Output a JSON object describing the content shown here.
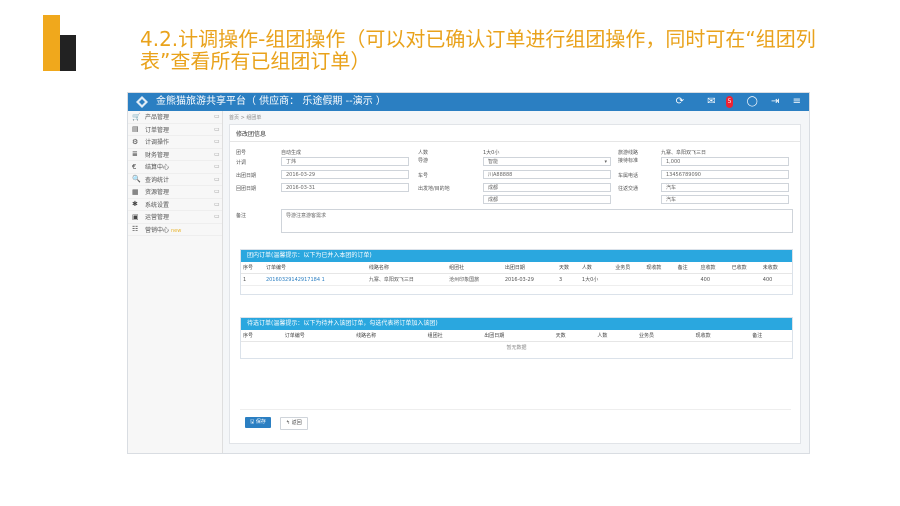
{
  "slide": {
    "title": "4.2.计调操作-组团操作（可以对已确认订单进行组团操作，同时可在“组团列表”查看所有已组团订单）"
  },
  "app": {
    "brand": "金熊猫旅游共享平台（ 供应商： 乐途假期 --演示 ）",
    "toolbar": [
      "⟳",
      "✉",
      "◯",
      "⇥",
      "≡"
    ],
    "mail_badge": "5"
  },
  "sidebar": {
    "items": [
      {
        "icon": "🛒",
        "icon_name": "cart-icon",
        "label": "产品管理"
      },
      {
        "icon": "▤",
        "icon_name": "list-icon",
        "label": "订单管理"
      },
      {
        "icon": "⚙",
        "icon_name": "gear-icon",
        "label": "计调操作"
      },
      {
        "icon": "≣",
        "icon_name": "bars-icon",
        "label": "财务管理"
      },
      {
        "icon": "€",
        "icon_name": "currency-icon",
        "label": "结算中心"
      },
      {
        "icon": "🔍",
        "icon_name": "search-icon",
        "label": "查询统计"
      },
      {
        "icon": "▦",
        "icon_name": "database-icon",
        "label": "资源管理"
      },
      {
        "icon": "✱",
        "icon_name": "settings-icon",
        "label": "系统设置"
      },
      {
        "icon": "▣",
        "icon_name": "monitor-icon",
        "label": "运营管理"
      },
      {
        "icon": "☷",
        "icon_name": "grid-icon",
        "label": "营销中心",
        "badge": "new"
      }
    ]
  },
  "main": {
    "breadcrumb": "首页 > 组团单",
    "panel_title": "修改团信息",
    "form": {
      "row1": {
        "team_no_label": "团号",
        "team_no_value": "自动生成",
        "people_label": "人数",
        "people_value": "1大0小",
        "route_label": "旅游线路",
        "route_value": "九寨、阜阳双飞三日"
      },
      "row2": {
        "guide_label": "计调",
        "guide_value": "丁炜",
        "leader_label": "导游",
        "leader_value": "智能",
        "cost_label": "接待标准",
        "cost_value": "1,000"
      },
      "row3": {
        "depart_label": "出团日期",
        "depart_value": "2016-03-29",
        "car_label": "车号",
        "car_value": "川A88888",
        "phone_label": "车属电话",
        "phone_value": "13456789090"
      },
      "row4": {
        "return_label": "回团日期",
        "return_value": "2016-03-31",
        "place_label": "出发地/目的地",
        "place_value1": "成都",
        "place_value2": "成都",
        "traffic_label": "往返交通",
        "traffic_value1": "汽车",
        "traffic_value2": "汽车"
      },
      "remark_label": "备注",
      "remark_value": "导游注意游客需求"
    },
    "in_team": {
      "header": "团内订单(温馨提示：以下为已并入本团的订单)",
      "columns": [
        "序号",
        "订单编号",
        "线路名称",
        "组团社",
        "出团日期",
        "天数",
        "人数",
        "业务员",
        "现收款",
        "备注",
        "应收款",
        "已收款",
        "未收款"
      ],
      "rows": [
        [
          "1",
          "20160329142917184 1",
          "九寨、阜阳双飞三日",
          "沧州印象国旅",
          "2016-03-29",
          "3",
          "1大0小",
          "",
          "",
          "",
          "400",
          "",
          "400"
        ]
      ]
    },
    "pending": {
      "header": "待选订单(温馨提示：以下为待并入该团订单，勾选代表将订单加入该团)",
      "columns": [
        "序号",
        "订单编号",
        "线路名称",
        "组团社",
        "出团日期",
        "天数",
        "人数",
        "业务员",
        "现收款",
        "备注"
      ],
      "empty": "暂无数据"
    },
    "buttons": {
      "save": "🖫 保存",
      "back": "↰ 返回"
    }
  }
}
